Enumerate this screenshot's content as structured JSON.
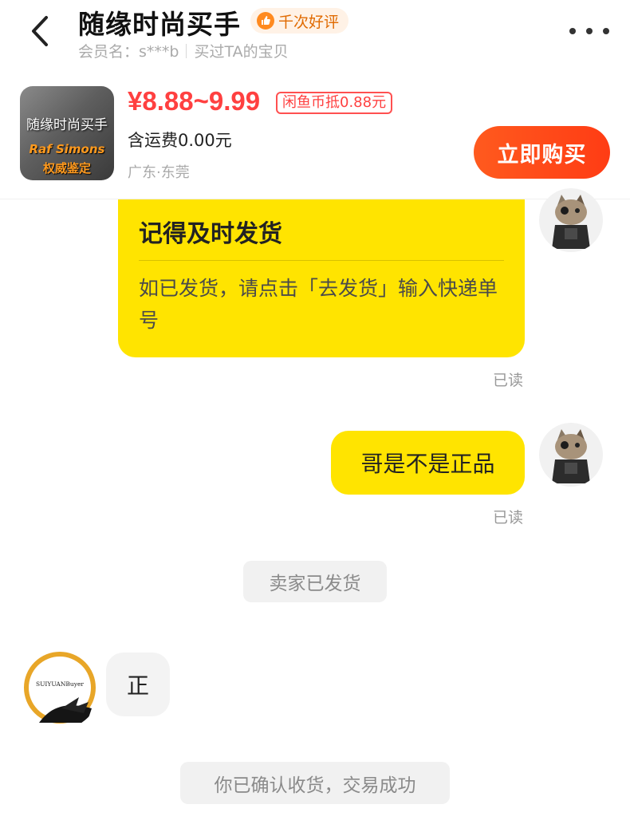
{
  "header": {
    "shop_name": "随缘时尚买手",
    "badge": "千次好评",
    "member_label": "会员名：s***b",
    "bought_label": "买过TA的宝贝"
  },
  "product": {
    "image_text_1": "随缘时尚买手",
    "image_text_2": "Raf Simons",
    "image_text_3": "权威鉴定",
    "price": "¥8.88~9.99",
    "coin_offer": "闲鱼币抵0.88元",
    "shipping": "含运费0.00元",
    "location": "广东·东莞",
    "buy_button": "立即购买"
  },
  "messages": {
    "card_title": "记得及时发货",
    "card_body": "如已发货，请点击「去发货」输入快递单号",
    "read_1": "已读",
    "my_message": "哥是不是正品",
    "read_2": "已读",
    "system_shipped": "卖家已发货",
    "seller_reply": "正",
    "seller_avatar_text": "SUIYUANBuyer",
    "system_confirmed": "你已确认收货，交易成功"
  },
  "colors": {
    "bubble_yellow": "#ffe400",
    "price_red": "#ff4040",
    "buy_orange": "#ff4a1a"
  }
}
